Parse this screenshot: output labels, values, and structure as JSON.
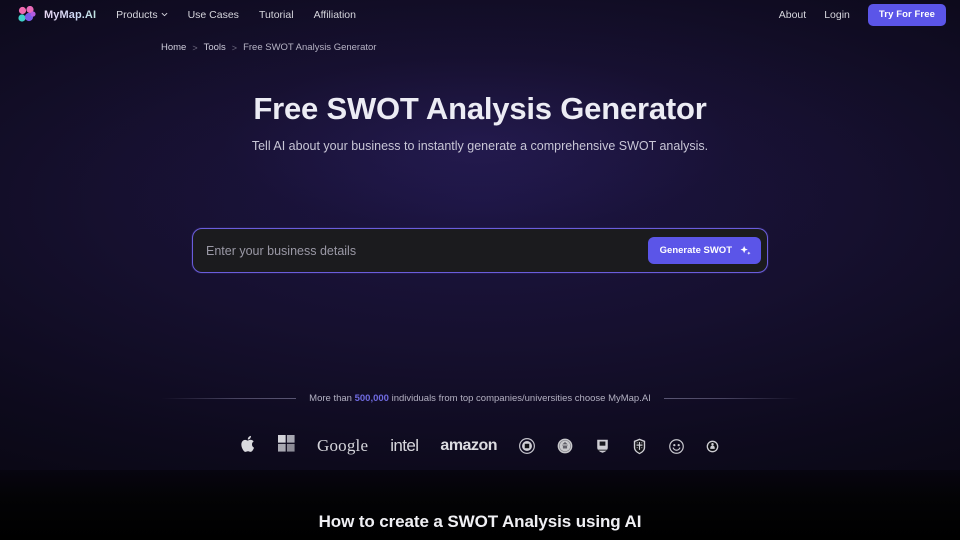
{
  "brand": {
    "name": "MyMap.AI",
    "logo_icon": "mymap-cluster-logo"
  },
  "nav": {
    "links": [
      {
        "label": "Products",
        "has_dropdown": true,
        "icon": "chevron-down-icon"
      },
      {
        "label": "Use Cases",
        "has_dropdown": false
      },
      {
        "label": "Tutorial",
        "has_dropdown": false
      },
      {
        "label": "Affiliation",
        "has_dropdown": false
      }
    ],
    "right_links": [
      {
        "label": "About"
      },
      {
        "label": "Login"
      }
    ],
    "cta_label": "Try For Free"
  },
  "breadcrumb": {
    "items": [
      {
        "label": "Home"
      },
      {
        "label": "Tools"
      },
      {
        "label": "Free SWOT Analysis Generator"
      }
    ],
    "separator": ">"
  },
  "hero": {
    "title": "Free SWOT Analysis Generator",
    "subtitle": "Tell AI about your business to instantly generate a comprehensive SWOT analysis."
  },
  "prompt": {
    "placeholder": "Enter your business details",
    "value": "",
    "button_label": "Generate SWOT",
    "button_icon": "sparkle-icon"
  },
  "social_proof": {
    "prefix": "More than ",
    "count": "500,000",
    "suffix": " individuals from top companies/universities choose MyMap.AI"
  },
  "logos": [
    {
      "name": "apple",
      "type": "icon",
      "label": ""
    },
    {
      "name": "microsoft",
      "type": "icon",
      "label": ""
    },
    {
      "name": "google",
      "type": "wordmark",
      "label": "Google"
    },
    {
      "name": "intel",
      "type": "wordmark",
      "label": "intel"
    },
    {
      "name": "amazon",
      "type": "wordmark",
      "label": "amazon"
    },
    {
      "name": "university-seal-1",
      "type": "seal",
      "label": ""
    },
    {
      "name": "university-seal-2",
      "type": "seal",
      "label": ""
    },
    {
      "name": "university-seal-3",
      "type": "seal",
      "label": ""
    },
    {
      "name": "university-seal-4",
      "type": "seal",
      "label": ""
    },
    {
      "name": "university-seal-5",
      "type": "seal",
      "label": ""
    },
    {
      "name": "university-seal-6",
      "type": "seal",
      "label": ""
    }
  ],
  "section": {
    "heading": "How to create a SWOT Analysis using AI"
  },
  "colors": {
    "accent": "#5b55e8",
    "accent_text": "#6f6ae0",
    "input_border": "#6a5ddb",
    "page_bg": "#08060f"
  }
}
